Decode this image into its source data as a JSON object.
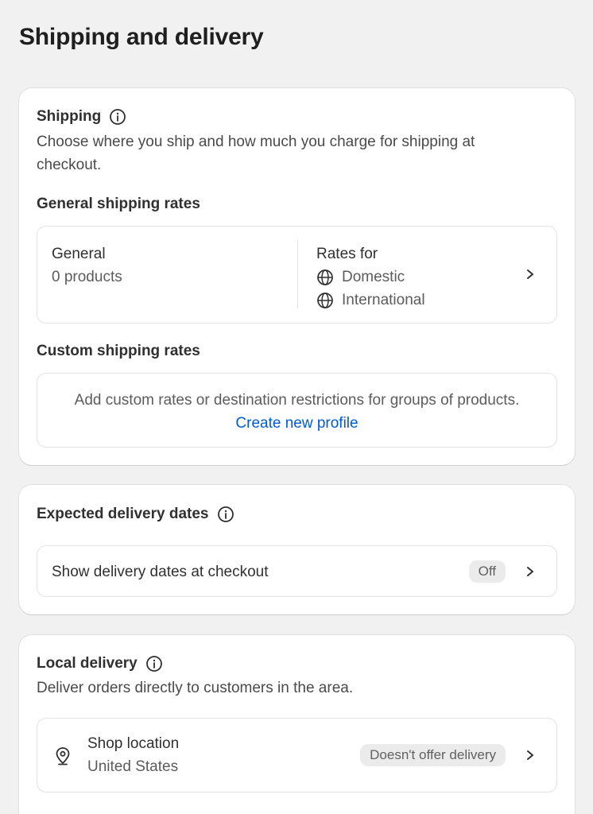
{
  "page": {
    "title": "Shipping and delivery"
  },
  "shipping": {
    "title": "Shipping",
    "description": "Choose where you ship and how much you charge for shipping at checkout.",
    "general_heading": "General shipping rates",
    "general": {
      "name": "General",
      "products": "0 products",
      "rates_title": "Rates for",
      "rates": [
        "Domestic",
        "International"
      ]
    },
    "custom_heading": "Custom shipping rates",
    "custom": {
      "text": "Add custom rates or destination restrictions for groups of products.",
      "link": "Create new profile"
    }
  },
  "delivery_dates": {
    "title": "Expected delivery dates",
    "row_label": "Show delivery dates at checkout",
    "status": "Off"
  },
  "local_delivery": {
    "title": "Local delivery",
    "description": "Deliver orders directly to customers in the area.",
    "location_title": "Shop location",
    "location_country": "United States",
    "status": "Doesn't offer delivery"
  },
  "icons": {
    "info": "info-icon",
    "globe": "globe-icon",
    "chevron": "chevron-right-icon",
    "pin": "location-pin-icon"
  },
  "colors": {
    "link": "#005bd3",
    "background": "#f1f1f1",
    "card": "#ffffff"
  }
}
